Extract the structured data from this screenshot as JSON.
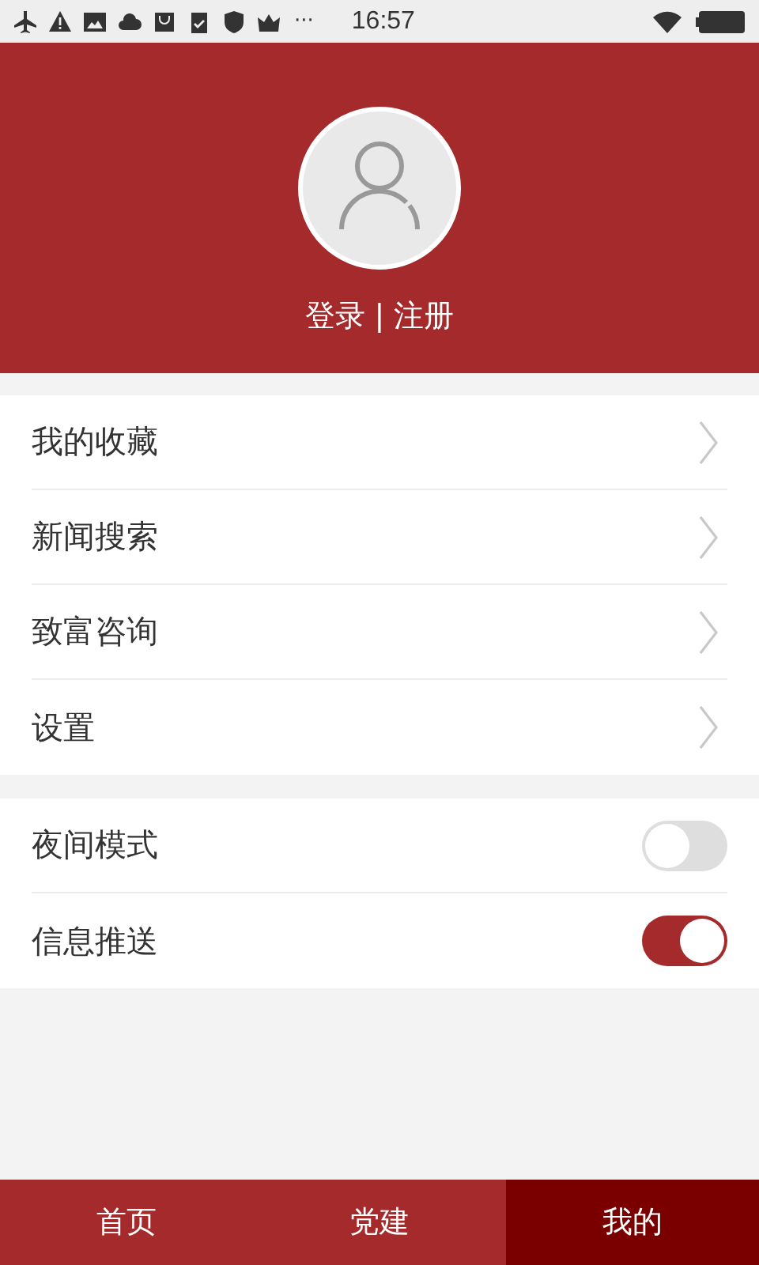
{
  "status_bar": {
    "more": "···",
    "time": "16:57"
  },
  "header": {
    "login_text": "登录 | 注册"
  },
  "menu": [
    {
      "label": "我的收藏"
    },
    {
      "label": "新闻搜索"
    },
    {
      "label": "致富咨询"
    },
    {
      "label": "设置"
    }
  ],
  "toggles": [
    {
      "label": "夜间模式",
      "on": false
    },
    {
      "label": "信息推送",
      "on": true
    }
  ],
  "tabs": [
    {
      "label": "首页",
      "selected": false
    },
    {
      "label": "党建",
      "selected": false
    },
    {
      "label": "我的",
      "selected": true
    }
  ]
}
